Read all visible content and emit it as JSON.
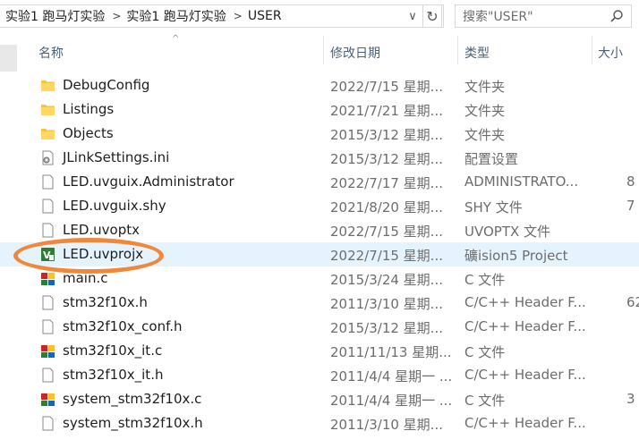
{
  "address": {
    "crumbs": [
      "实验1 跑马灯实验",
      "实验1 跑马灯实验",
      "USER"
    ],
    "separator": ">",
    "dropdown_glyph": "∨",
    "refresh_glyph": "↻"
  },
  "search": {
    "placeholder": "搜索\"USER\""
  },
  "columns": {
    "name": "名称",
    "date": "修改日期",
    "type": "类型",
    "size": "大小",
    "sort_glyph": "^"
  },
  "rows": [
    {
      "name": "DebugConfig",
      "date": "2022/7/15 星期...",
      "type": "文件夹",
      "size": "",
      "icon": "folder-icon"
    },
    {
      "name": "Listings",
      "date": "2021/7/21 星期...",
      "type": "文件夹",
      "size": "",
      "icon": "folder-icon"
    },
    {
      "name": "Objects",
      "date": "2015/3/12 星期...",
      "type": "文件夹",
      "size": "",
      "icon": "folder-icon"
    },
    {
      "name": "JLinkSettings.ini",
      "date": "2015/3/12 星期...",
      "type": "配置设置",
      "size": "",
      "icon": "settings-file-icon"
    },
    {
      "name": "LED.uvguix.Administrator",
      "date": "2022/7/17 星期...",
      "type": "ADMINISTRATO...",
      "size": "8",
      "icon": "file-icon"
    },
    {
      "name": "LED.uvguix.shy",
      "date": "2021/8/20 星期...",
      "type": "SHY 文件",
      "size": "7",
      "icon": "file-icon"
    },
    {
      "name": "LED.uvoptx",
      "date": "2022/7/15 星期...",
      "type": "UVOPTX 文件",
      "size": "",
      "icon": "file-icon"
    },
    {
      "name": "LED.uvprojx",
      "date": "2022/7/15 星期...",
      "type": "礦ision5 Project",
      "size": "",
      "icon": "keil-project-icon"
    },
    {
      "name": "main.c",
      "date": "2015/3/24 星期...",
      "type": "C 文件",
      "size": "",
      "icon": "c-file-icon"
    },
    {
      "name": "stm32f10x.h",
      "date": "2011/3/10 星期...",
      "type": "C/C++ Header F...",
      "size": "62",
      "icon": "file-icon"
    },
    {
      "name": "stm32f10x_conf.h",
      "date": "2015/3/12 星期...",
      "type": "C/C++ Header F...",
      "size": "",
      "icon": "file-icon"
    },
    {
      "name": "stm32f10x_it.c",
      "date": "2011/11/13 星期...",
      "type": "C 文件",
      "size": "",
      "icon": "c-file-icon"
    },
    {
      "name": "stm32f10x_it.h",
      "date": "2011/4/4 星期一 ...",
      "type": "C/C++ Header F...",
      "size": "",
      "icon": "file-icon"
    },
    {
      "name": "system_stm32f10x.c",
      "date": "2011/4/4 星期一 ...",
      "type": "C 文件",
      "size": "3",
      "icon": "c-file-icon"
    },
    {
      "name": "system_stm32f10x.h",
      "date": "2011/3/10 星期...",
      "type": "C/C++ Header F...",
      "size": "",
      "icon": "file-icon"
    }
  ],
  "highlighted_row": 7,
  "colors": {
    "header_text": "#4c607a",
    "highlight": "#e5f3ff",
    "annotation": "#f0883a",
    "folder": "#f5c542"
  }
}
